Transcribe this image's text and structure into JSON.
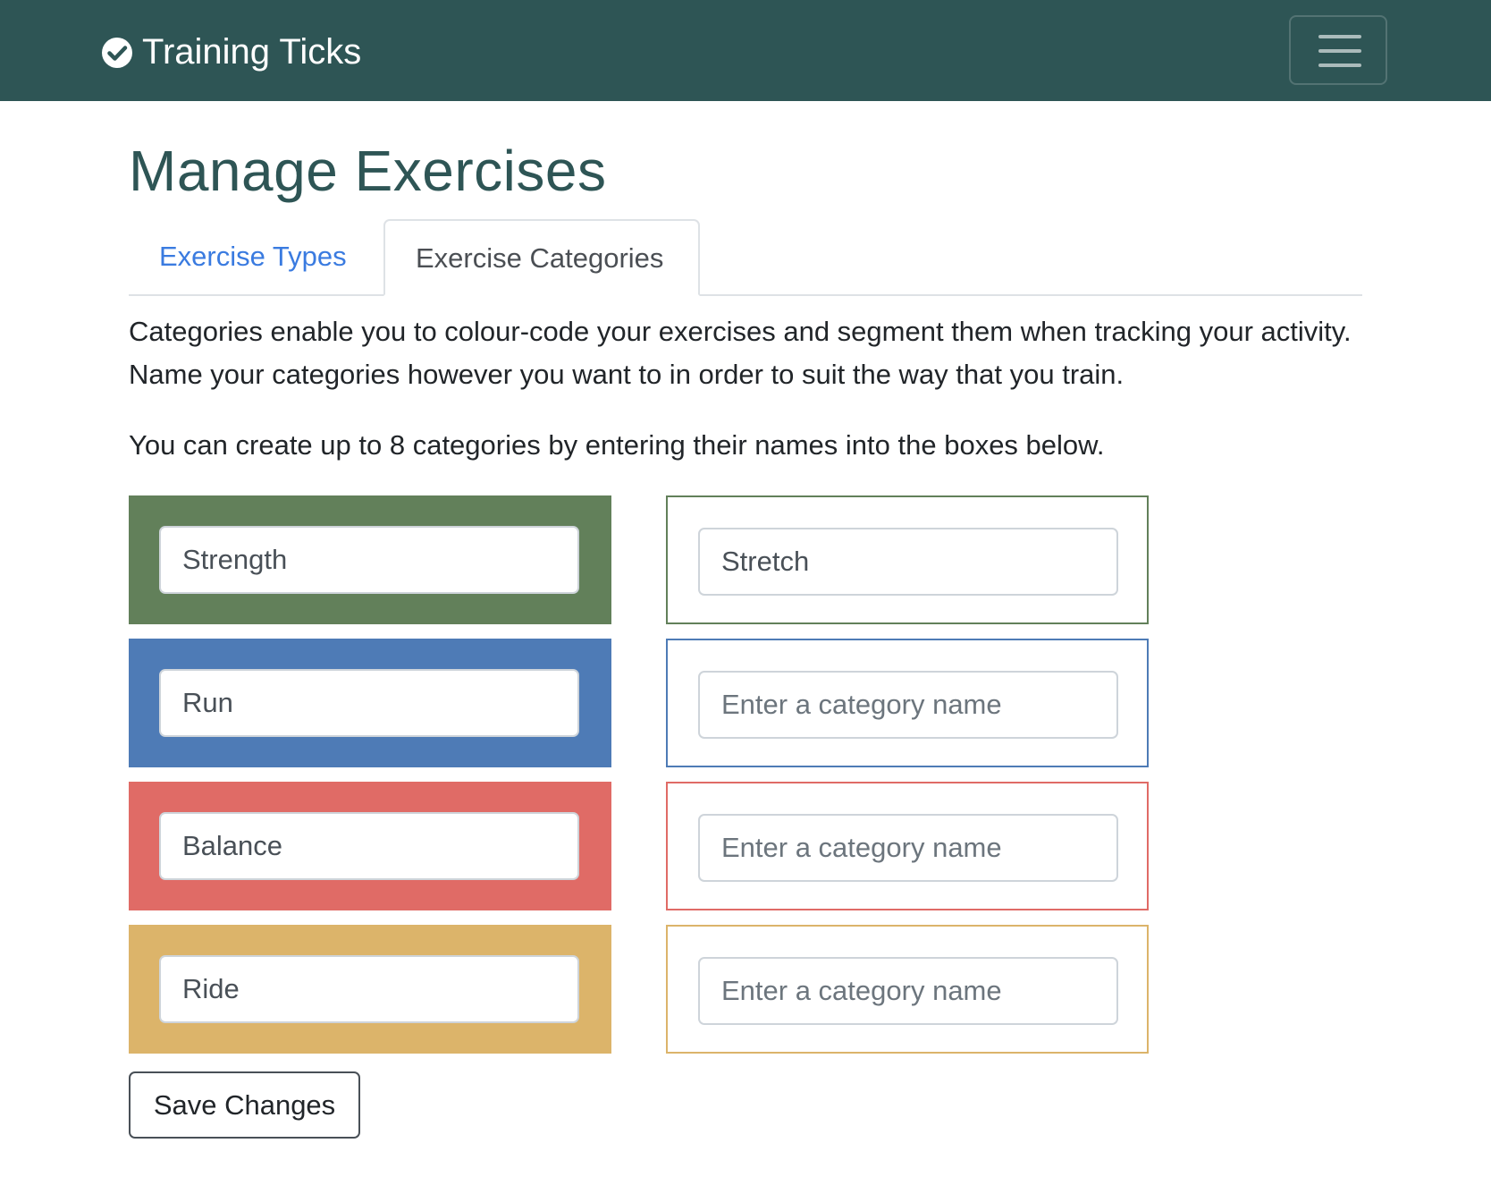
{
  "navbar": {
    "brand": "Training Ticks",
    "brand_icon": "check-circle-icon",
    "menu_icon": "hamburger-menu-icon"
  },
  "page": {
    "title": "Manage Exercises"
  },
  "tabs": [
    {
      "label": "Exercise Types",
      "active": false
    },
    {
      "label": "Exercise Categories",
      "active": true
    }
  ],
  "intro": "Categories enable you to colour-code your exercises and segment them when tracking your activity. Name your categories however you want to in order to suit the way that you train.",
  "limit_note": "You can create up to 8 categories by entering their names into the boxes below.",
  "categories": {
    "placeholder": "Enter a category name",
    "rows": [
      {
        "color": "#62805a",
        "left_value": "Strength",
        "right_value": "Stretch"
      },
      {
        "color": "#4e7bb6",
        "left_value": "Run",
        "right_value": ""
      },
      {
        "color": "#e06b66",
        "left_value": "Balance",
        "right_value": ""
      },
      {
        "color": "#dcb46a",
        "left_value": "Ride",
        "right_value": ""
      }
    ]
  },
  "save_button": "Save Changes",
  "colors": {
    "navbar": "#2e5555",
    "title": "#2e5555",
    "link": "#3a7be0"
  }
}
